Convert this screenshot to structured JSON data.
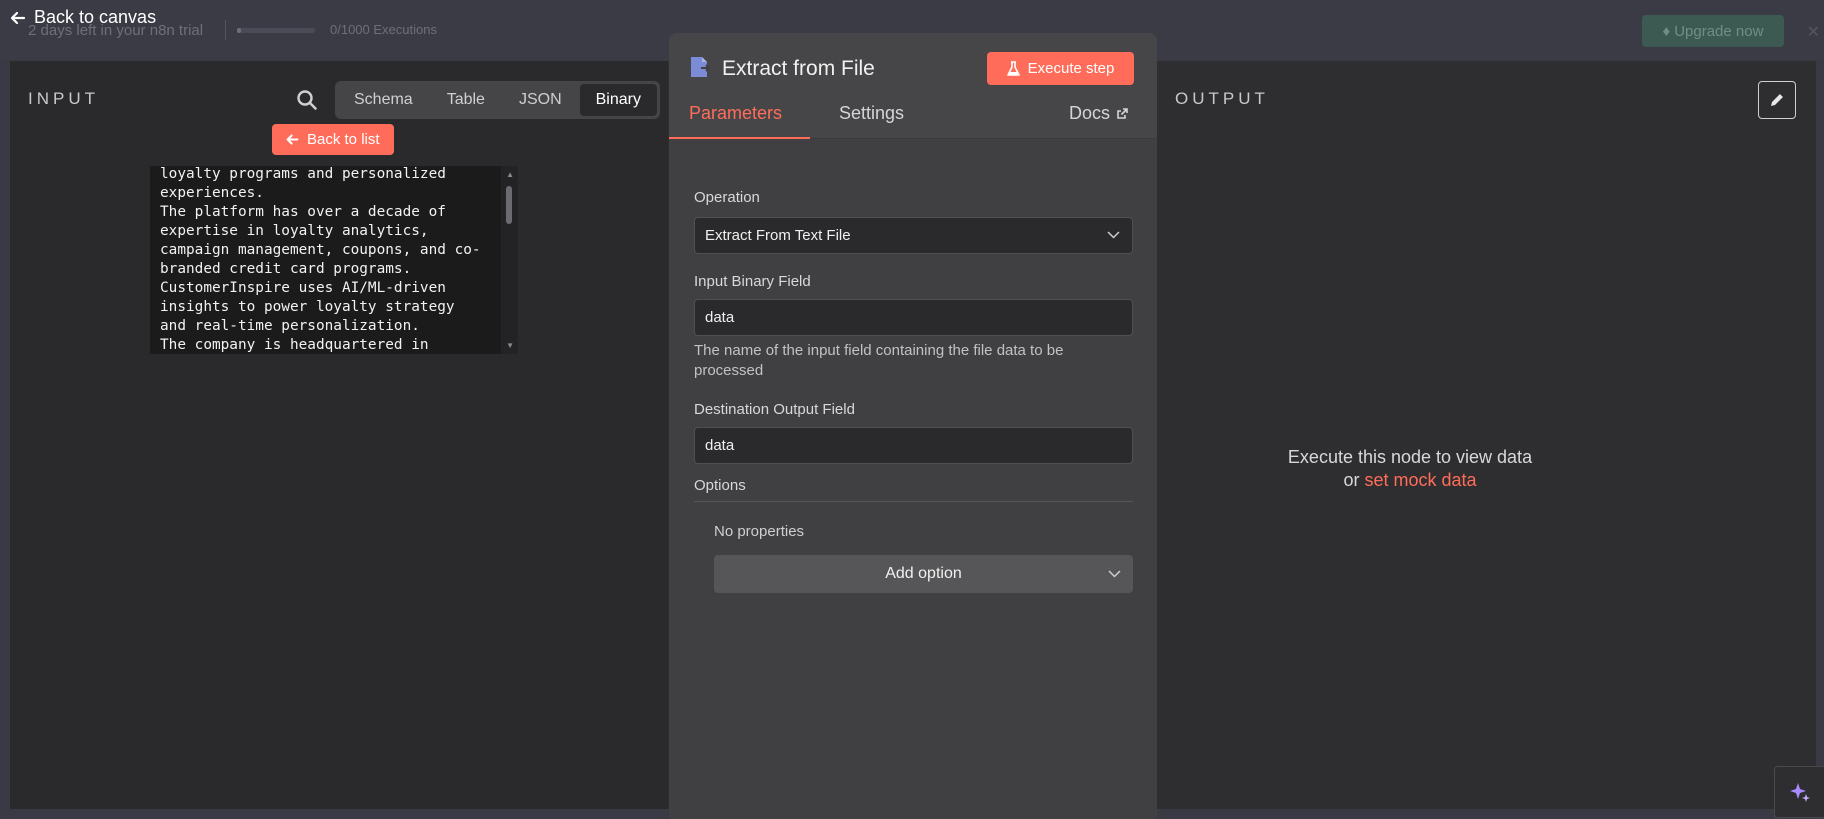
{
  "trial": {
    "text": "2 days left in your n8n trial",
    "executions": "0/1000 Executions",
    "upgrade_label": "Upgrade now"
  },
  "nav": {
    "back_to_canvas": "Back to canvas"
  },
  "input_panel": {
    "title": "INPUT",
    "view_tabs": [
      "Schema",
      "Table",
      "JSON",
      "Binary"
    ],
    "active_tab": "Binary",
    "back_to_list": "Back to list",
    "file_text": "loyalty programs and personalized\nexperiences.\nThe platform has over a decade of\nexpertise in loyalty analytics,\ncampaign management, coupons, and co-\nbranded credit card programs.\nCustomerInspire uses AI/ML-driven\ninsights to power loyalty strategy\nand real-time personalization.\nThe company is headquartered in"
  },
  "node": {
    "title": "Extract from File",
    "execute_label": "Execute step",
    "tabs": {
      "parameters": "Parameters",
      "settings": "Settings",
      "docs": "Docs"
    },
    "operation": {
      "label": "Operation",
      "value": "Extract From Text File"
    },
    "input_binary_field": {
      "label": "Input Binary Field",
      "value": "data",
      "hint": "The name of the input field containing the file data to be processed"
    },
    "destination_output_field": {
      "label": "Destination Output Field",
      "value": "data"
    },
    "options": {
      "label": "Options",
      "empty_text": "No properties",
      "add_label": "Add option"
    }
  },
  "output_panel": {
    "title": "OUTPUT",
    "empty_line1": "Execute this node to view data",
    "empty_or": "or",
    "mock_link": "set mock data"
  },
  "colors": {
    "accent": "#ff6d5a",
    "panel": "#2e2e30",
    "node_panel": "#404042"
  },
  "icons": [
    "arrow-left-icon",
    "search-icon",
    "file-icon",
    "flask-icon",
    "external-link-icon",
    "chevron-down-icon",
    "pencil-icon",
    "sparkle-icon",
    "gem-icon"
  ]
}
